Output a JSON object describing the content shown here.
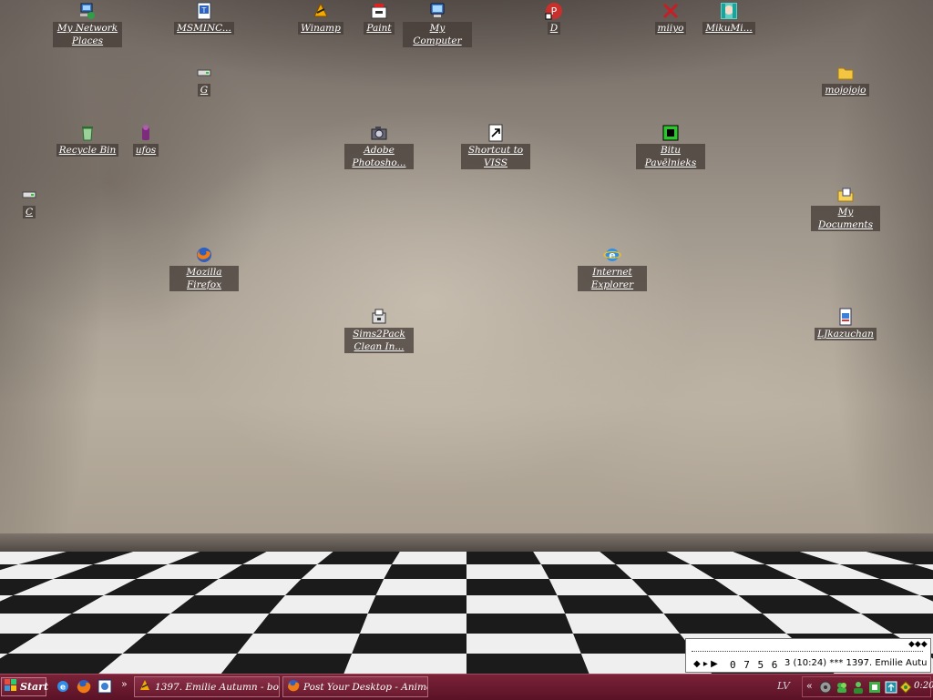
{
  "desktop": {
    "icons": [
      {
        "label": "My Network Places",
        "icon": "network-places-icon"
      },
      {
        "label": "MSMINC...",
        "icon": "document-icon"
      },
      {
        "label": "Winamp",
        "icon": "winamp-icon"
      },
      {
        "label": "Paint",
        "icon": "paint-icon"
      },
      {
        "label": "My Computer",
        "icon": "computer-icon"
      },
      {
        "label": "D",
        "icon": "shortcut-icon"
      },
      {
        "label": "miiyo",
        "icon": "x-icon"
      },
      {
        "label": "MikuMi...",
        "icon": "anime-icon"
      },
      {
        "label": "G",
        "icon": "drive-icon"
      },
      {
        "label": "mojojojo",
        "icon": "folder-icon"
      },
      {
        "label": "Recycle Bin",
        "icon": "recycle-bin-icon"
      },
      {
        "label": "ufos",
        "icon": "ufos-icon"
      },
      {
        "label": "Adobe Photosho...",
        "icon": "camera-icon"
      },
      {
        "label": "Shortcut to VISS",
        "icon": "shortcut-icon"
      },
      {
        "label": "Bitu Pavēlnieks",
        "icon": "program-icon"
      },
      {
        "label": "C",
        "icon": "drive-icon"
      },
      {
        "label": "My Documents",
        "icon": "documents-icon"
      },
      {
        "label": "Mozilla Firefox",
        "icon": "firefox-icon"
      },
      {
        "label": "Internet Explorer",
        "icon": "ie-icon"
      },
      {
        "label": "Sims2Pack Clean In...",
        "icon": "installer-icon"
      },
      {
        "label": "LJkazuchan",
        "icon": "file-icon"
      }
    ]
  },
  "player": {
    "time": "0 7 5 6",
    "track": "3 (10:24) *** 1397. Emilie Autu"
  },
  "taskbar": {
    "start_label": "Start",
    "tasks": [
      {
        "label": "1397. Emilie Autumn - bonus...",
        "icon": "winamp-icon"
      },
      {
        "label": "Post Your Desktop - Anime ...",
        "icon": "firefox-icon"
      }
    ],
    "chevron": "»",
    "language": "LV",
    "tray_chevron": "«",
    "clock": "0:20"
  }
}
